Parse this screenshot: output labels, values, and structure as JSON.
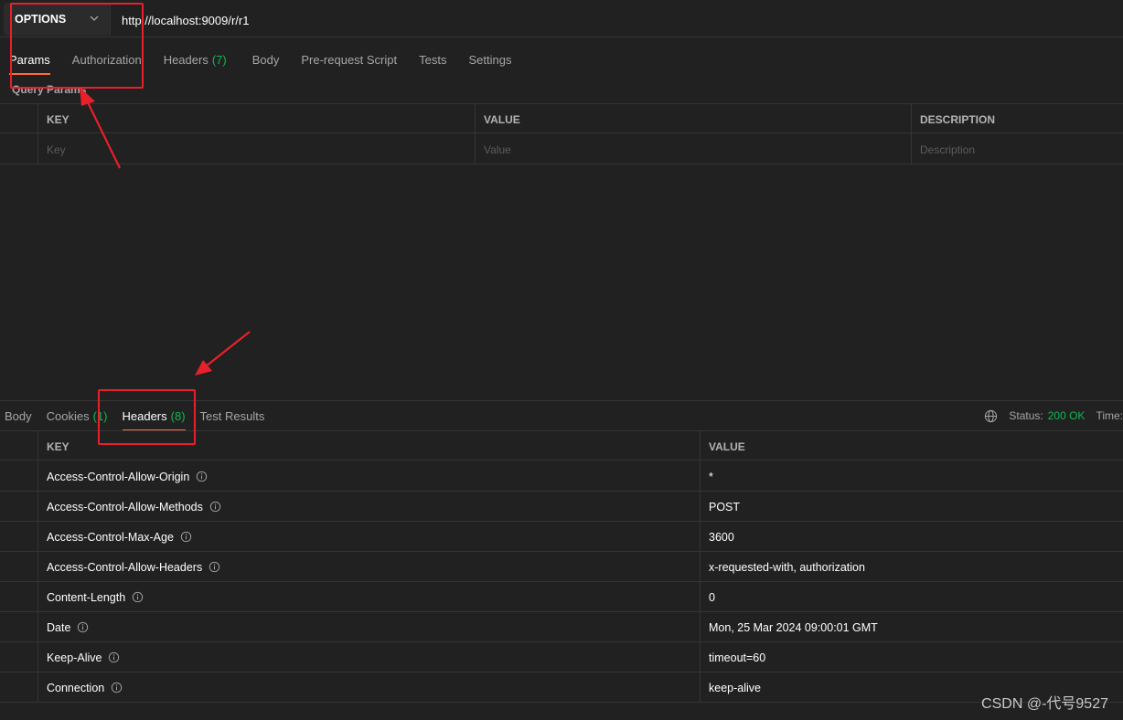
{
  "request": {
    "method": "OPTIONS",
    "url": "http://localhost:9009/r/r1",
    "tabs": [
      {
        "label": "Params",
        "active": true
      },
      {
        "label": "Authorization"
      },
      {
        "label": "Headers",
        "count": "(7)"
      },
      {
        "label": "Body"
      },
      {
        "label": "Pre-request Script"
      },
      {
        "label": "Tests"
      },
      {
        "label": "Settings"
      }
    ],
    "section_title": "Query Params",
    "params_table": {
      "columns": [
        "KEY",
        "VALUE",
        "DESCRIPTION"
      ],
      "placeholders": {
        "key": "Key",
        "value": "Value",
        "description": "Description"
      }
    }
  },
  "response": {
    "tabs": [
      {
        "label": "Body"
      },
      {
        "label": "Cookies",
        "count": "(1)"
      },
      {
        "label": "Headers",
        "count": "(8)",
        "active": true
      },
      {
        "label": "Test Results"
      }
    ],
    "status_label": "Status:",
    "status_value": "200 OK",
    "time_label": "Time:",
    "headers_table": {
      "columns": [
        "KEY",
        "VALUE"
      ],
      "rows": [
        {
          "key": "Access-Control-Allow-Origin",
          "value": "*"
        },
        {
          "key": "Access-Control-Allow-Methods",
          "value": "POST"
        },
        {
          "key": "Access-Control-Max-Age",
          "value": "3600"
        },
        {
          "key": "Access-Control-Allow-Headers",
          "value": "x-requested-with, authorization"
        },
        {
          "key": "Content-Length",
          "value": "0"
        },
        {
          "key": "Date",
          "value": "Mon, 25 Mar 2024 09:00:01 GMT"
        },
        {
          "key": "Keep-Alive",
          "value": "timeout=60"
        },
        {
          "key": "Connection",
          "value": "keep-alive"
        }
      ]
    }
  },
  "watermark": "CSDN @-代号9527",
  "colors": {
    "background": "#212121",
    "accent": "#ff6c37",
    "success": "#0cbb52",
    "annotation": "#e8202a"
  },
  "icons": {
    "method_dropdown": "chevron-down-icon",
    "header_info": "info-icon",
    "network": "globe-icon"
  }
}
